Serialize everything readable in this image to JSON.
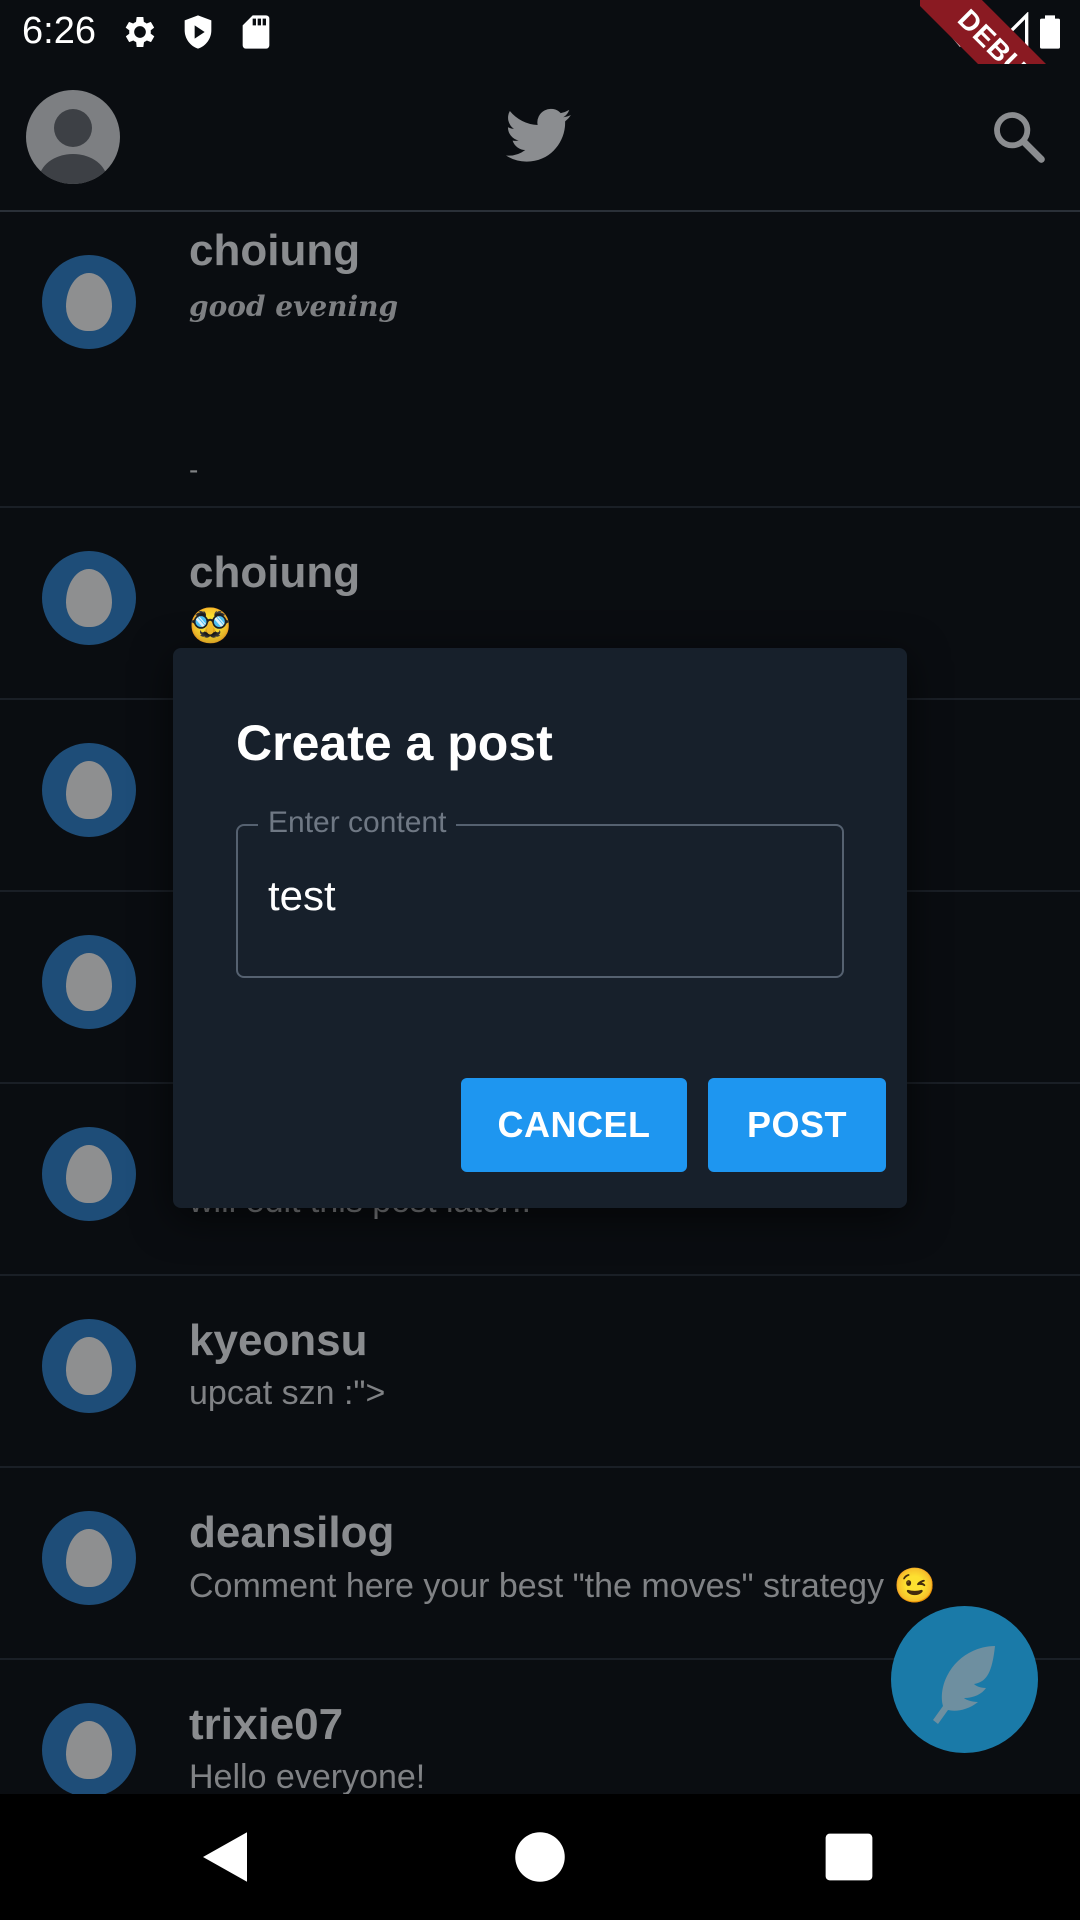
{
  "status_bar": {
    "time": "6:26",
    "debug_label": "DEBUG",
    "icons": [
      "gear-icon",
      "shield-icon",
      "sd-card-icon",
      "wifi-icon",
      "signal-icon",
      "battery-icon"
    ]
  },
  "app_bar": {
    "icons": [
      "avatar",
      "twitter-bird-icon",
      "search-icon"
    ]
  },
  "feed": [
    {
      "user": "choiung",
      "text": "good evening",
      "extra": "-"
    },
    {
      "user": "choiung",
      "text": "🥸"
    },
    {
      "user": "",
      "text": ""
    },
    {
      "user": "",
      "text": ""
    },
    {
      "user": "",
      "text": "will edit this post later!!"
    },
    {
      "user": "kyeonsu",
      "text": "upcat szn :\">"
    },
    {
      "user": "deansilog",
      "text": "Comment here your best \"the moves\" strategy 😉"
    },
    {
      "user": "trixie07",
      "text": "Hello everyone!"
    }
  ],
  "dialog": {
    "title": "Create a post",
    "field_label": "Enter content",
    "field_value": "test",
    "cancel_label": "CANCEL",
    "post_label": "POST"
  },
  "fab": {
    "icon": "feather-icon"
  },
  "nav_bar": {
    "icons": [
      "back-icon",
      "home-icon",
      "recents-icon"
    ]
  },
  "colors": {
    "background": "#0a0d11",
    "dialog": "#17202b",
    "accent": "#1e96f0",
    "avatar_blue": "#1e4d78"
  }
}
